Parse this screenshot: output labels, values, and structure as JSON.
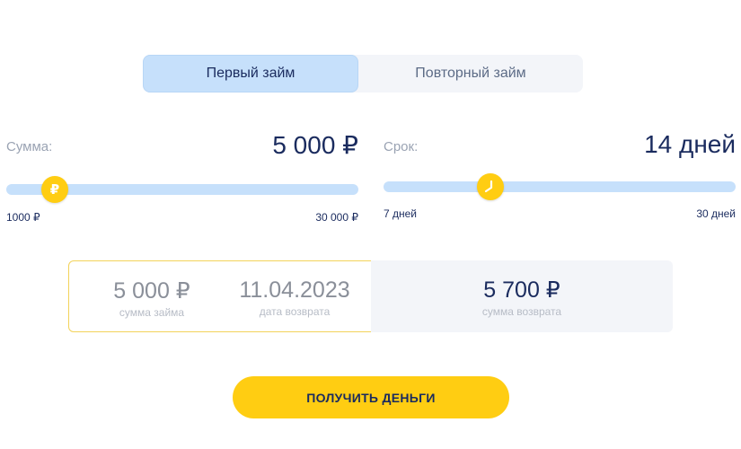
{
  "tabs": [
    {
      "label": "Первый займ",
      "active": true
    },
    {
      "label": "Повторный займ",
      "active": false
    }
  ],
  "amount": {
    "label": "Сумма:",
    "value": "5 000 ₽",
    "min": "1000 ₽",
    "max": "30 000 ₽",
    "thumb_icon": "ruble-icon",
    "thumb_glyph": "₽",
    "position_fraction": 0.14
  },
  "term": {
    "label": "Срок:",
    "value": "14 дней",
    "min": "7 дней",
    "max": "30 дней",
    "thumb_icon": "clock-icon",
    "position_fraction": 0.3
  },
  "summary": {
    "loan_amount": "5 000 ₽",
    "loan_amount_caption": "сумма займа",
    "return_date": "11.04.2023",
    "return_date_caption": "дата возврата",
    "return_amount": "5 700 ₽",
    "return_amount_caption": "сумма возврата"
  },
  "cta": {
    "label": "ПОЛУЧИТЬ ДЕНЬГИ"
  },
  "colors": {
    "accent_yellow": "#ffcd12",
    "track_blue": "#c6e0fb",
    "text_dark": "#1a2b5e",
    "panel_gray": "#f3f5f9"
  }
}
